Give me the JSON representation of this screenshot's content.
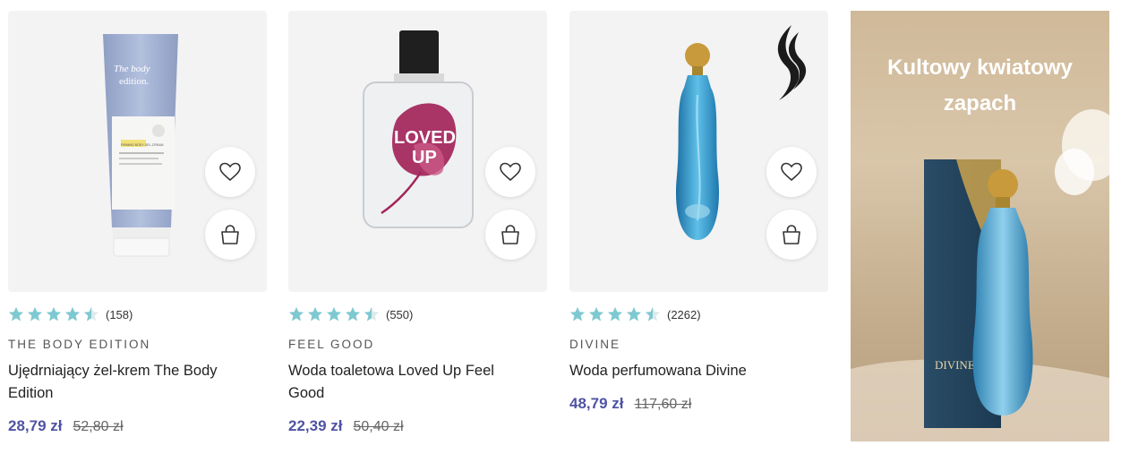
{
  "products": [
    {
      "rating_count": "(158)",
      "brand": "THE BODY EDITION",
      "name": "Ujędrniający żel-krem The Body Edition",
      "price": "28,79 zł",
      "old_price": "52,80 zł",
      "image_text": {
        "line1": "The body",
        "line2": "edition.",
        "label": "FIRMING BODY GEL-CREAM"
      }
    },
    {
      "rating_count": "(550)",
      "brand": "FEEL GOOD",
      "name": "Woda toaletowa Loved Up Feel Good",
      "price": "22,39 zł",
      "old_price": "50,40 zł",
      "image_text": {
        "line1": "LOVED",
        "line2": "UP"
      }
    },
    {
      "rating_count": "(2262)",
      "brand": "DIVINE",
      "name": "Woda perfumowana Divine",
      "price": "48,79 zł",
      "old_price": "117,60 zł"
    }
  ],
  "promo": {
    "title_line1": "Kultowy kwiatowy",
    "title_line2": "zapach",
    "box_text": "DIVINE"
  },
  "rating_value": 4.5,
  "colors": {
    "star": "#7ec9d1",
    "price": "#4f53a3",
    "image_bg": "#f3f3f3"
  },
  "icons": {
    "wishlist": "heart-icon",
    "cart": "shopping-bag-icon",
    "rating": "star-icon"
  }
}
